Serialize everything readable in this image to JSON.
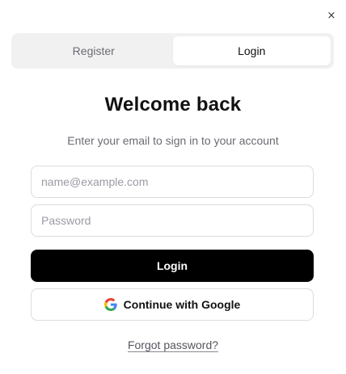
{
  "dialog": {
    "close_label": "×"
  },
  "tabs": [
    {
      "label": "Register",
      "active": false
    },
    {
      "label": "Login",
      "active": true
    }
  ],
  "header": {
    "title": "Welcome back",
    "subtitle": "Enter your email to sign in to your account"
  },
  "form": {
    "email": {
      "value": "",
      "placeholder": "name@example.com"
    },
    "password": {
      "value": "",
      "placeholder": "Password"
    },
    "login_label": "Login",
    "google_label": "Continue with Google",
    "forgot_label": "Forgot password?"
  },
  "colors": {
    "primary_button": "#000000",
    "tab_track": "#f1f1f2",
    "muted_text": "#6b6b73"
  },
  "icons": {
    "close": "close-icon",
    "google": "google-icon"
  }
}
